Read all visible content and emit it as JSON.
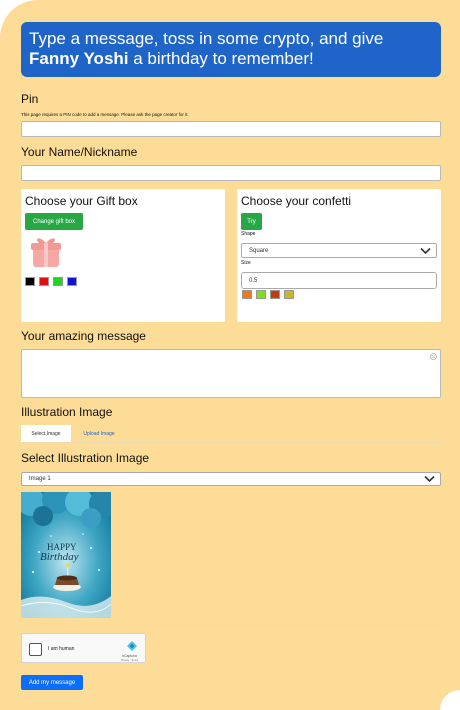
{
  "banner": {
    "text_before": "Type a message, toss in some crypto, and give ",
    "name": "Fanny Yoshi",
    "text_after": " a birthday to remember!"
  },
  "pin": {
    "label": "Pin",
    "note": "This page requires a PIN code to add a message. Please ask the page creator for it.",
    "value": ""
  },
  "name_field": {
    "label": "Your Name/Nickname",
    "value": ""
  },
  "gift_box": {
    "title": "Choose your Gift box",
    "button_label": "Change gift box",
    "colors": [
      "#000000",
      "#e01010",
      "#22d322",
      "#1414d8"
    ]
  },
  "confetti": {
    "title": "Choose your confetti",
    "try_label": "Try",
    "shape_label": "Shape",
    "shape_value": "Square",
    "size_label": "Size",
    "size_value": "0.5",
    "colors": [
      "#f07818",
      "#7ee01c",
      "#c43a12",
      "#c9b42a"
    ]
  },
  "message": {
    "label": "Your amazing message",
    "value": ""
  },
  "illustration": {
    "label": "Illustration Image",
    "tabs": [
      "Select Image",
      "Upload Image"
    ],
    "active_tab": "Select Image",
    "select_label": "Select Illustration Image",
    "selected": "Image 1",
    "image_text_line1": "HAPPY",
    "image_text_line2": "Birthday"
  },
  "captcha": {
    "label": "I am human",
    "brand": "hCaptcha",
    "sub": "Privacy - Terms"
  },
  "submit_label": "Add my message"
}
